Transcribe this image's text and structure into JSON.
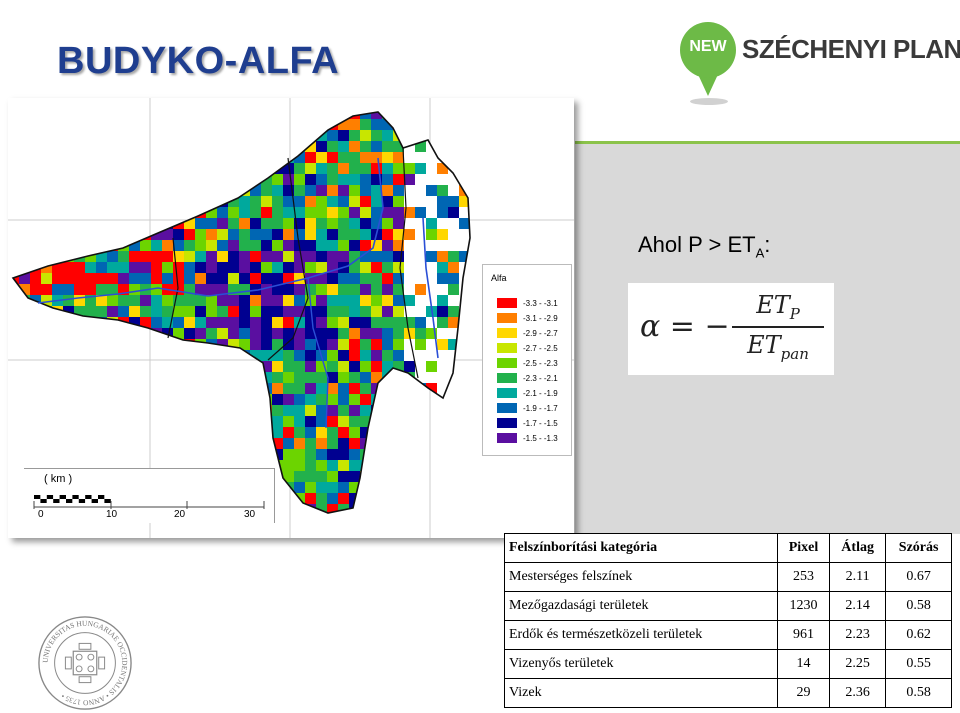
{
  "title": "BUDYKO-ALFA",
  "logo": {
    "pin_text": "NEW",
    "brand_text": "SZÉCHENYI PLAN",
    "color": "#6dba47"
  },
  "condition": {
    "prefix": "Ahol P > ET",
    "sub": "A",
    "suffix": ":"
  },
  "formula": {
    "lhs": "α = −",
    "num": "ET",
    "num_sub": "P",
    "den": "ET",
    "den_sub": "pan"
  },
  "map": {
    "legend": {
      "title": "Alfa",
      "items": [
        {
          "label": "-3.3 - -3.1",
          "color": "#ff0000"
        },
        {
          "label": "-3.1 - -2.9",
          "color": "#ff7f00"
        },
        {
          "label": "-2.9 - -2.7",
          "color": "#ffd700"
        },
        {
          "label": "-2.7 - -2.5",
          "color": "#c8e600"
        },
        {
          "label": "-2.5 - -2.3",
          "color": "#6cd400"
        },
        {
          "label": "-2.3 - -2.1",
          "color": "#22b14c"
        },
        {
          "label": "-2.1 - -1.9",
          "color": "#00a99d"
        },
        {
          "label": "-1.9 - -1.7",
          "color": "#0066b3"
        },
        {
          "label": "-1.7 - -1.5",
          "color": "#000090"
        },
        {
          "label": "-1.5 - -1.3",
          "color": "#5a0fa0"
        }
      ]
    },
    "scale": {
      "unit": "( km )",
      "ticks": [
        "0",
        "10",
        "20",
        "30"
      ]
    }
  },
  "table": {
    "headers": [
      "Felszínborítási kategória",
      "Pixel",
      "Átlag",
      "Szórás"
    ],
    "rows": [
      [
        "Mesterséges felszínek",
        "253",
        "2.11",
        "0.67"
      ],
      [
        "Mezőgazdasági területek",
        "1230",
        "2.14",
        "0.58"
      ],
      [
        "Erdők és természetközeli területek",
        "961",
        "2.23",
        "0.62"
      ],
      [
        "Vizenyős területek",
        "14",
        "2.25",
        "0.55"
      ],
      [
        "Vizek",
        "29",
        "2.36",
        "0.58"
      ]
    ]
  },
  "seal": {
    "text": "UNIVERSITAS HUNGARIAE OCCIDENTALIS • ANNO 1735 •"
  }
}
